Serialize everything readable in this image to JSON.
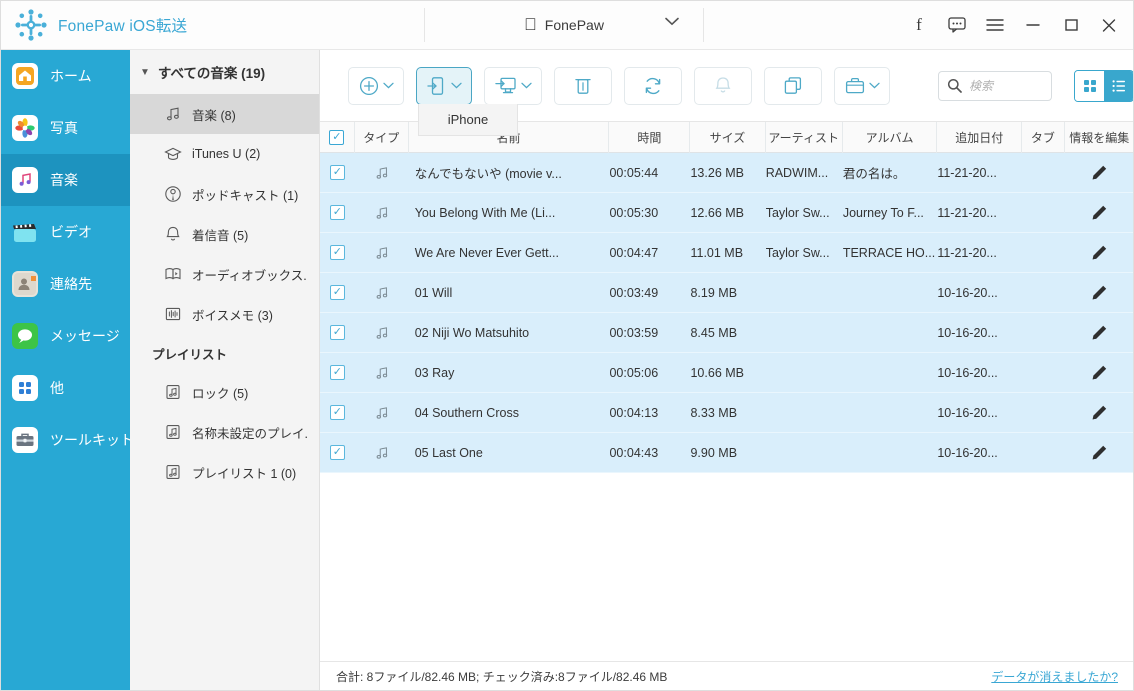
{
  "window": {
    "brand_name": "FonePaw iOS転送",
    "device_name": "FonePaw",
    "controls": {
      "facebook": "f",
      "feedback": "feedback-bubble",
      "menu": "menu",
      "minimize": "minimize",
      "maximize": "maximize",
      "close": "close"
    }
  },
  "rail": {
    "items": [
      {
        "label": "ホーム",
        "icon": "home-icon",
        "active": false
      },
      {
        "label": "写真",
        "icon": "photos-icon",
        "active": false
      },
      {
        "label": "音楽",
        "icon": "music-icon",
        "active": true
      },
      {
        "label": "ビデオ",
        "icon": "video-icon",
        "active": false
      },
      {
        "label": "連絡先",
        "icon": "contacts-icon",
        "active": false
      },
      {
        "label": "メッセージ",
        "icon": "messages-icon",
        "active": false
      },
      {
        "label": "他",
        "icon": "other-icon",
        "active": false
      },
      {
        "label": "ツールキット",
        "icon": "toolkit-icon",
        "active": false
      }
    ]
  },
  "categories": {
    "header": "すべての音楽 (19)",
    "items": [
      {
        "label": "音楽 (8)",
        "icon": "music-note-icon",
        "active": true
      },
      {
        "label": "iTunes U (2)",
        "icon": "itunes-u-icon",
        "active": false
      },
      {
        "label": "ポッドキャスト (1)",
        "icon": "podcast-icon",
        "active": false
      },
      {
        "label": "着信音 (5)",
        "icon": "ringtone-icon",
        "active": false
      },
      {
        "label": "オーディオブックス.",
        "icon": "audiobook-icon",
        "active": false
      },
      {
        "label": "ボイスメモ (3)",
        "icon": "voicememo-icon",
        "active": false
      }
    ],
    "playlist_header": "プレイリスト",
    "playlists": [
      {
        "label": "ロック (5)",
        "icon": "playlist-icon"
      },
      {
        "label": "名称未設定のプレイ.",
        "icon": "playlist-icon"
      },
      {
        "label": "プレイリスト 1 (0)",
        "icon": "playlist-icon"
      }
    ]
  },
  "toolbar": {
    "buttons": [
      {
        "name": "add-button",
        "icon": "plus-icon",
        "caret": true,
        "state": "normal"
      },
      {
        "name": "export-to-device",
        "icon": "export-to-phone-icon",
        "caret": true,
        "state": "selected"
      },
      {
        "name": "export-to-pc",
        "icon": "export-to-pc-icon",
        "caret": true,
        "state": "normal"
      },
      {
        "name": "delete-button",
        "icon": "trash-icon",
        "caret": false,
        "state": "normal"
      },
      {
        "name": "refresh-button",
        "icon": "sync-icon",
        "caret": false,
        "state": "normal"
      },
      {
        "name": "ringtone-maker-button",
        "icon": "bell-icon",
        "caret": false,
        "state": "disabled"
      },
      {
        "name": "deduplicate-button",
        "icon": "copy-icon",
        "caret": false,
        "state": "normal"
      },
      {
        "name": "toolkit-button",
        "icon": "briefcase-icon",
        "caret": true,
        "state": "normal"
      }
    ],
    "tooltip": "iPhone",
    "search_placeholder": "検索",
    "search_value": "",
    "view_grid": "grid-view-icon",
    "view_list": "list-view-icon",
    "view_active": "list"
  },
  "table": {
    "columns": [
      "タイプ",
      "名前",
      "時間",
      "サイズ",
      "アーティスト",
      "アルバム",
      "追加日付",
      "タブ",
      "情報を編集"
    ],
    "select_all_checked": true,
    "rows": [
      {
        "checked": true,
        "type": "music-note-icon",
        "name": "なんでもないや (movie v...",
        "time": "00:05:44",
        "size": "13.26 MB",
        "artist": "RADWIM...",
        "album": "君の名は。",
        "date": "11-21-20...",
        "tab": "",
        "edit": "pencil-icon"
      },
      {
        "checked": true,
        "type": "music-note-icon",
        "name": "You Belong With Me (Li...",
        "time": "00:05:30",
        "size": "12.66 MB",
        "artist": "Taylor Sw...",
        "album": "Journey To F...",
        "date": "11-21-20...",
        "tab": "",
        "edit": "pencil-icon"
      },
      {
        "checked": true,
        "type": "music-note-icon",
        "name": "We Are Never Ever Gett...",
        "time": "00:04:47",
        "size": "11.01 MB",
        "artist": "Taylor Sw...",
        "album": "TERRACE HO...",
        "date": "11-21-20...",
        "tab": "",
        "edit": "pencil-icon"
      },
      {
        "checked": true,
        "type": "music-note-icon",
        "name": "01 Will",
        "time": "00:03:49",
        "size": "8.19 MB",
        "artist": "",
        "album": "",
        "date": "10-16-20...",
        "tab": "",
        "edit": "pencil-icon"
      },
      {
        "checked": true,
        "type": "music-note-icon",
        "name": "02 Niji Wo Matsuhito",
        "time": "00:03:59",
        "size": "8.45 MB",
        "artist": "",
        "album": "",
        "date": "10-16-20...",
        "tab": "",
        "edit": "pencil-icon"
      },
      {
        "checked": true,
        "type": "music-note-icon",
        "name": "03 Ray",
        "time": "00:05:06",
        "size": "10.66 MB",
        "artist": "",
        "album": "",
        "date": "10-16-20...",
        "tab": "",
        "edit": "pencil-icon"
      },
      {
        "checked": true,
        "type": "music-note-icon",
        "name": "04 Southern Cross",
        "time": "00:04:13",
        "size": "8.33 MB",
        "artist": "",
        "album": "",
        "date": "10-16-20...",
        "tab": "",
        "edit": "pencil-icon"
      },
      {
        "checked": true,
        "type": "music-note-icon",
        "name": "05 Last One",
        "time": "00:04:43",
        "size": "9.90 MB",
        "artist": "",
        "album": "",
        "date": "10-16-20...",
        "tab": "",
        "edit": "pencil-icon"
      }
    ]
  },
  "status": {
    "summary": "合計: 8ファイル/82.46 MB; チェック済み:8ファイル/82.46 MB",
    "link": "データが消えましたか?"
  },
  "colors": {
    "brand": "#3aa7d4",
    "rail": "#28a8d4",
    "rail_active": "#1d93bf",
    "row_selected": "#d9eefb",
    "toolbar_icon": "#4ea9c7"
  }
}
